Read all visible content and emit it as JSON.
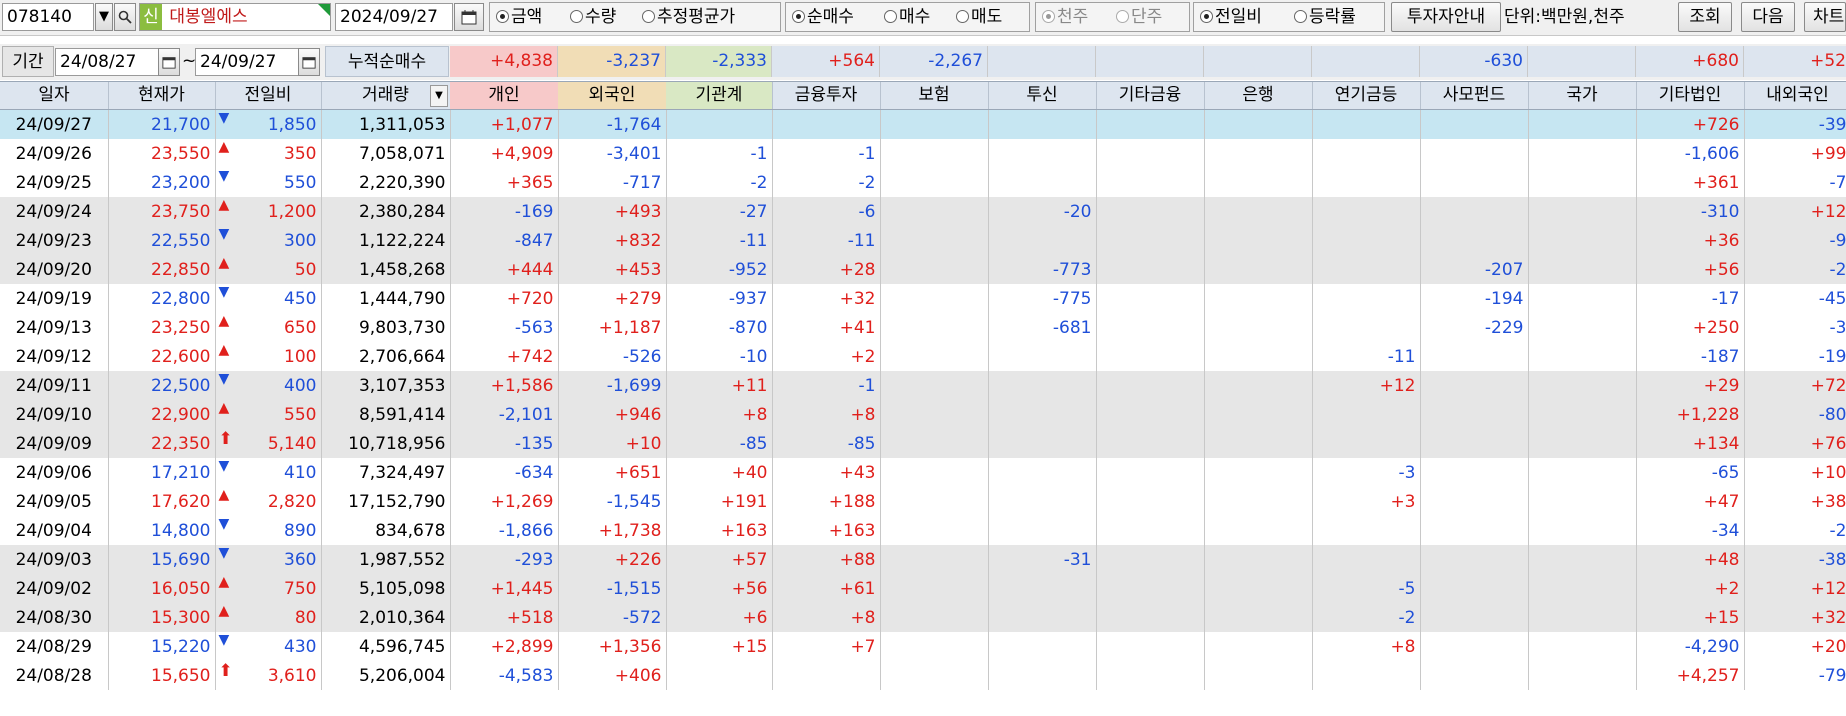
{
  "toolbar": {
    "stock_code": "078140",
    "badge": "신",
    "stock_name": "대봉엘에스",
    "date": "2024/09/27",
    "type_options": [
      "금액",
      "수량",
      "추정평균가"
    ],
    "trade_options": [
      "순매수",
      "매수",
      "매도"
    ],
    "unit_options": [
      "천주",
      "단주"
    ],
    "compare_options": [
      "전일비",
      "등락률"
    ],
    "investor_guide": "투자자안내",
    "unit_label": "단위:백만원,천주",
    "query": "조회",
    "next": "다음",
    "chart": "차트"
  },
  "period": {
    "label": "기간",
    "from": "24/08/27",
    "tilde": "~",
    "to": "24/09/27",
    "cumulative_label": "누적순매수"
  },
  "summary": [
    "+4,838",
    "-3,237",
    "-2,333",
    "+564",
    "-2,267",
    "",
    "",
    "",
    "",
    "-630",
    "",
    "+680",
    "+52"
  ],
  "columns": [
    "일자",
    "현재가",
    "전일비",
    "거래량",
    "개인",
    "외국인",
    "기관계",
    "금융투자",
    "보험",
    "투신",
    "기타금융",
    "은행",
    "연기금등",
    "사모펀드",
    "국가",
    "기타법인",
    "내외국인"
  ],
  "rows": [
    {
      "date": "24/09/27",
      "price": "21,700",
      "dir": "down",
      "chg": "1,850",
      "vol": "1,311,053",
      "vals": [
        "+1,077",
        "-1,764",
        "",
        "",
        "",
        "",
        "",
        "",
        "",
        "",
        "",
        "+726",
        "-39"
      ]
    },
    {
      "date": "24/09/26",
      "price": "23,550",
      "dir": "up",
      "chg": "350",
      "vol": "7,058,071",
      "vals": [
        "+4,909",
        "-3,401",
        "-1",
        "-1",
        "",
        "",
        "",
        "",
        "",
        "",
        "",
        "-1,606",
        "+99"
      ]
    },
    {
      "date": "24/09/25",
      "price": "23,200",
      "dir": "down",
      "chg": "550",
      "vol": "2,220,390",
      "vals": [
        "+365",
        "-717",
        "-2",
        "-2",
        "",
        "",
        "",
        "",
        "",
        "",
        "",
        "+361",
        "-7"
      ]
    },
    {
      "date": "24/09/24",
      "price": "23,750",
      "dir": "up",
      "chg": "1,200",
      "vol": "2,380,284",
      "vals": [
        "-169",
        "+493",
        "-27",
        "-6",
        "",
        "-20",
        "",
        "",
        "",
        "",
        "",
        "-310",
        "+12"
      ]
    },
    {
      "date": "24/09/23",
      "price": "22,550",
      "dir": "down",
      "chg": "300",
      "vol": "1,122,224",
      "vals": [
        "-847",
        "+832",
        "-11",
        "-11",
        "",
        "",
        "",
        "",
        "",
        "",
        "",
        "+36",
        "-9"
      ]
    },
    {
      "date": "24/09/20",
      "price": "22,850",
      "dir": "up",
      "chg": "50",
      "vol": "1,458,268",
      "vals": [
        "+444",
        "+453",
        "-952",
        "+28",
        "",
        "-773",
        "",
        "",
        "",
        "-207",
        "",
        "+56",
        "-2"
      ]
    },
    {
      "date": "24/09/19",
      "price": "22,800",
      "dir": "down",
      "chg": "450",
      "vol": "1,444,790",
      "vals": [
        "+720",
        "+279",
        "-937",
        "+32",
        "",
        "-775",
        "",
        "",
        "",
        "-194",
        "",
        "-17",
        "-45"
      ]
    },
    {
      "date": "24/09/13",
      "price": "23,250",
      "dir": "up",
      "chg": "650",
      "vol": "9,803,730",
      "vals": [
        "-563",
        "+1,187",
        "-870",
        "+41",
        "",
        "-681",
        "",
        "",
        "",
        "-229",
        "",
        "+250",
        "-3"
      ]
    },
    {
      "date": "24/09/12",
      "price": "22,600",
      "dir": "up",
      "chg": "100",
      "vol": "2,706,664",
      "vals": [
        "+742",
        "-526",
        "-10",
        "+2",
        "",
        "",
        "",
        "",
        "-11",
        "",
        "",
        "-187",
        "-19"
      ]
    },
    {
      "date": "24/09/11",
      "price": "22,500",
      "dir": "down",
      "chg": "400",
      "vol": "3,107,353",
      "vals": [
        "+1,586",
        "-1,699",
        "+11",
        "-1",
        "",
        "",
        "",
        "",
        "+12",
        "",
        "",
        "+29",
        "+72"
      ]
    },
    {
      "date": "24/09/10",
      "price": "22,900",
      "dir": "up",
      "chg": "550",
      "vol": "8,591,414",
      "vals": [
        "-2,101",
        "+946",
        "+8",
        "+8",
        "",
        "",
        "",
        "",
        "",
        "",
        "",
        "+1,228",
        "-80"
      ]
    },
    {
      "date": "24/09/09",
      "price": "22,350",
      "dir": "limitup",
      "chg": "5,140",
      "vol": "10,718,956",
      "vals": [
        "-135",
        "+10",
        "-85",
        "-85",
        "",
        "",
        "",
        "",
        "",
        "",
        "",
        "+134",
        "+76"
      ]
    },
    {
      "date": "24/09/06",
      "price": "17,210",
      "dir": "down",
      "chg": "410",
      "vol": "7,324,497",
      "vals": [
        "-634",
        "+651",
        "+40",
        "+43",
        "",
        "",
        "",
        "",
        "-3",
        "",
        "",
        "-65",
        "+10"
      ]
    },
    {
      "date": "24/09/05",
      "price": "17,620",
      "dir": "up",
      "chg": "2,820",
      "vol": "17,152,790",
      "vals": [
        "+1,269",
        "-1,545",
        "+191",
        "+188",
        "",
        "",
        "",
        "",
        "+3",
        "",
        "",
        "+47",
        "+38"
      ]
    },
    {
      "date": "24/09/04",
      "price": "14,800",
      "dir": "down",
      "chg": "890",
      "vol": "834,678",
      "vals": [
        "-1,866",
        "+1,738",
        "+163",
        "+163",
        "",
        "",
        "",
        "",
        "",
        "",
        "",
        "-34",
        "-2"
      ]
    },
    {
      "date": "24/09/03",
      "price": "15,690",
      "dir": "down",
      "chg": "360",
      "vol": "1,987,552",
      "vals": [
        "-293",
        "+226",
        "+57",
        "+88",
        "",
        "-31",
        "",
        "",
        "",
        "",
        "",
        "+48",
        "-38"
      ]
    },
    {
      "date": "24/09/02",
      "price": "16,050",
      "dir": "up",
      "chg": "750",
      "vol": "5,105,098",
      "vals": [
        "+1,445",
        "-1,515",
        "+56",
        "+61",
        "",
        "",
        "",
        "",
        "-5",
        "",
        "",
        "+2",
        "+12"
      ]
    },
    {
      "date": "24/08/30",
      "price": "15,300",
      "dir": "up",
      "chg": "80",
      "vol": "2,010,364",
      "vals": [
        "+518",
        "-572",
        "+6",
        "+8",
        "",
        "",
        "",
        "",
        "-2",
        "",
        "",
        "+15",
        "+32"
      ]
    },
    {
      "date": "24/08/29",
      "price": "15,220",
      "dir": "down",
      "chg": "430",
      "vol": "4,596,745",
      "vals": [
        "+2,899",
        "+1,356",
        "+15",
        "+7",
        "",
        "",
        "",
        "",
        "+8",
        "",
        "",
        "-4,290",
        "+20"
      ]
    },
    {
      "date": "24/08/28",
      "price": "15,650",
      "dir": "limitup",
      "chg": "3,610",
      "vol": "5,206,004",
      "vals": [
        "-4,583",
        "+406",
        "",
        "",
        "",
        "",
        "",
        "",
        "",
        "",
        "",
        "+4,257",
        "-79"
      ]
    }
  ],
  "row_shades": [
    "sel",
    "w",
    "w",
    "g",
    "g",
    "g",
    "w",
    "w",
    "w",
    "g",
    "g",
    "g",
    "w",
    "w",
    "w",
    "g",
    "g",
    "g",
    "w",
    "w"
  ],
  "colors": {
    "up": "#e0201c",
    "down": "#1f4fd8",
    "selected_row": "#c6e6f2",
    "shaded_row": "#e6e6e6",
    "header": "#dde5ef"
  },
  "icons": {
    "dropdown": "chevron-down-icon",
    "search": "search-icon",
    "calendar": "calendar-icon",
    "up": "triangle-up-icon",
    "down": "triangle-down-icon",
    "limitup": "arrow-up-icon"
  }
}
